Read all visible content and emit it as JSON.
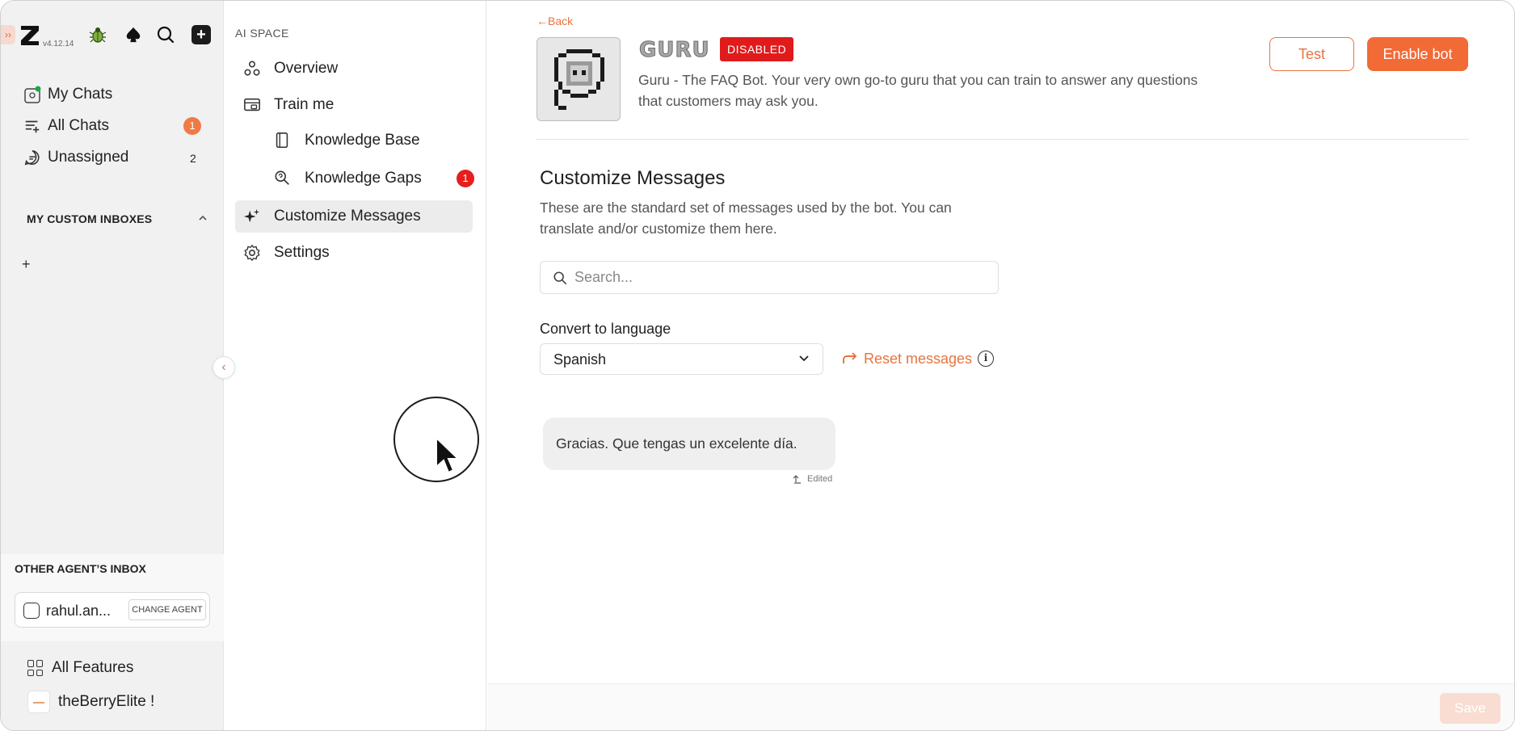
{
  "app": {
    "version": "v4.12.14",
    "expand_glyph": "››",
    "collapse_glyph": "‹"
  },
  "sidebar": {
    "inbox": [
      {
        "label": "My Chats",
        "badge": ""
      },
      {
        "label": "All Chats",
        "badge": "1"
      },
      {
        "label": "Unassigned",
        "badge": "2"
      }
    ],
    "custom_inboxes_title": "MY CUSTOM INBOXES",
    "add_glyph": "+",
    "other_inbox_title": "OTHER AGENT’S INBOX",
    "agent_name": "rahul.an...",
    "change_agent_label": "CHANGE AGENT",
    "all_features_label": "All Features",
    "org_name": "theBerryElite !"
  },
  "subnav": {
    "section_title": "AI SPACE",
    "items": [
      {
        "label": "Overview",
        "icon": "overview-icon"
      },
      {
        "label": "Train me",
        "icon": "train-icon"
      },
      {
        "label": "Knowledge Base",
        "icon": "book-icon"
      },
      {
        "label": "Knowledge Gaps",
        "icon": "gaps-icon",
        "badge": "1"
      },
      {
        "label": "Customize Messages",
        "icon": "sparkle-icon",
        "active": true
      },
      {
        "label": "Settings",
        "icon": "gear-icon"
      }
    ]
  },
  "header": {
    "back_label": "←Back",
    "bot_name": "GURU",
    "status_badge": "DISABLED",
    "description": "Guru - The FAQ Bot. Your very own go-to guru that you can train to answer any questions that customers may ask you.",
    "test_label": "Test",
    "enable_label": "Enable bot"
  },
  "customize": {
    "title": "Customize Messages",
    "description": "These are the standard set of messages used by the bot. You can translate and/or customize them here.",
    "search_placeholder": "Search...",
    "language_label": "Convert to language",
    "language_value": "Spanish",
    "reset_label": "Reset messages",
    "info_glyph": "i",
    "messages": [
      {
        "text": "Gracias. Que tengas un excelente día.",
        "status": "Edited"
      }
    ]
  },
  "footer": {
    "save_label": "Save"
  },
  "colors": {
    "accent": "#f26a36",
    "disabled_red": "#e01b1b",
    "sidebar_bg": "#f1f1f1"
  }
}
